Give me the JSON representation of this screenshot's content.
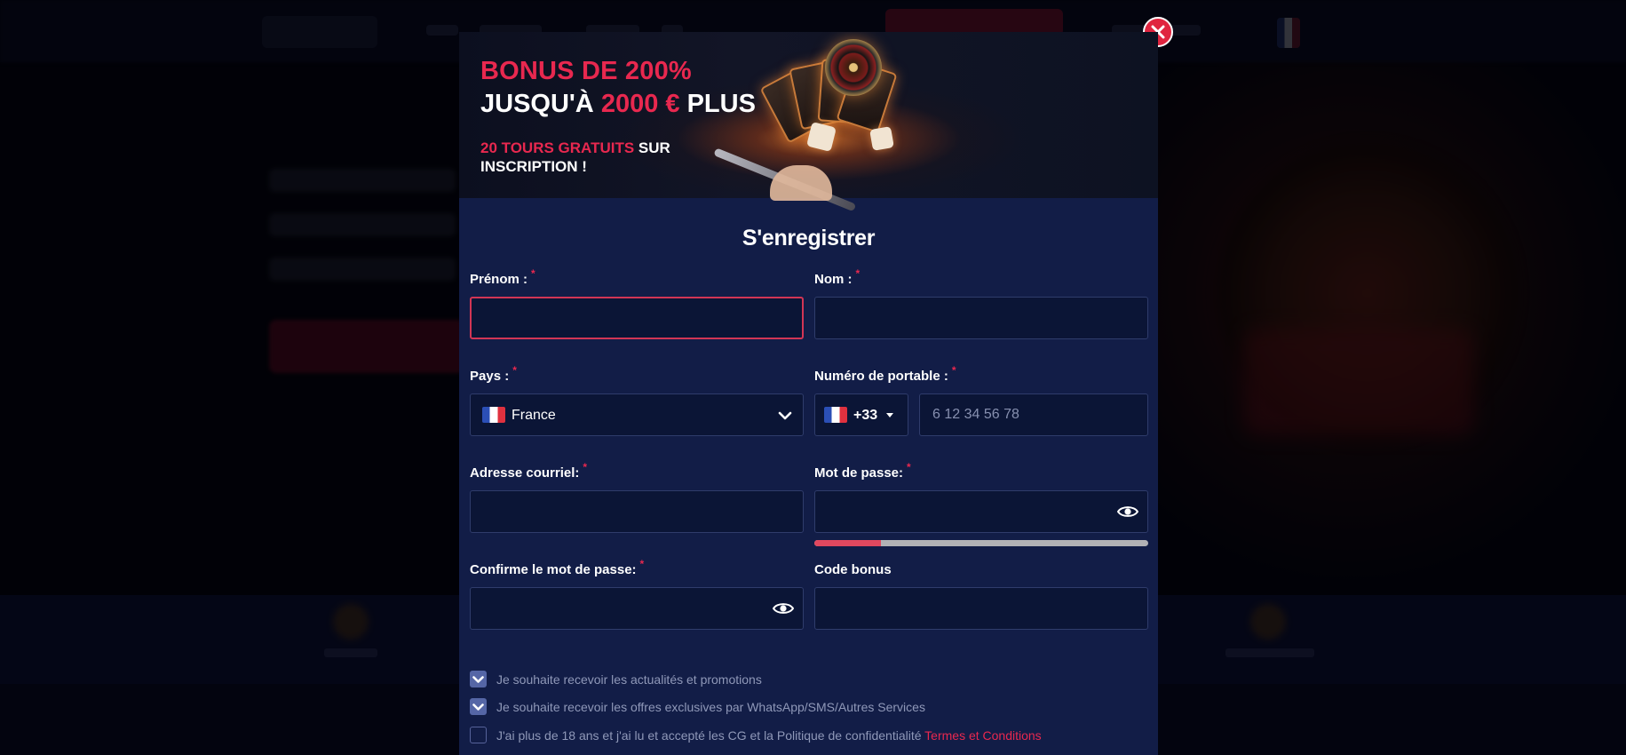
{
  "banner": {
    "line1": "BONUS DE 200%",
    "line2_prefix": "JUSQU'À ",
    "line2_amount": "2000 €",
    "line2_suffix": " PLUS",
    "sub_highlight": "20 TOURS GRATUITS",
    "sub_rest": " SUR INSCRIPTION !"
  },
  "form": {
    "title": "S'enregistrer",
    "required_mark": "*",
    "first_name": {
      "label": "Prénom :",
      "value": ""
    },
    "last_name": {
      "label": "Nom :",
      "value": ""
    },
    "country": {
      "label": "Pays :",
      "selected": "France"
    },
    "phone": {
      "label": "Numéro de portable :",
      "dial_code": "+33",
      "placeholder": "6 12 34 56 78",
      "value": ""
    },
    "email": {
      "label": "Adresse courriel:",
      "value": ""
    },
    "password": {
      "label": "Mot de passe:",
      "value": "",
      "strength": 0.2
    },
    "confirm_password": {
      "label": "Confirme le mot de passe:",
      "value": ""
    },
    "bonus_code": {
      "label": "Code bonus",
      "value": ""
    },
    "checkboxes": [
      {
        "text": "Je souhaite recevoir les actualités et promotions",
        "checked": true
      },
      {
        "text": "Je souhaite recevoir les offres exclusives par WhatsApp/SMS/Autres Services",
        "checked": true
      },
      {
        "text": "J'ai plus de 18 ans et j'ai lu et accepté les CG et la Politique de confidentialité ",
        "link": "Termes et Conditions",
        "checked": false
      }
    ]
  },
  "icons": {
    "close": "close-icon",
    "chevron": "chevron-down-icon",
    "eye": "eye-icon",
    "check": "check-icon",
    "flag": "france-flag-icon"
  },
  "colors": {
    "accent": "#e8284f",
    "modal_bg": "#121d47",
    "field_bg": "#0b1536",
    "close_bg": "#e0243f"
  }
}
